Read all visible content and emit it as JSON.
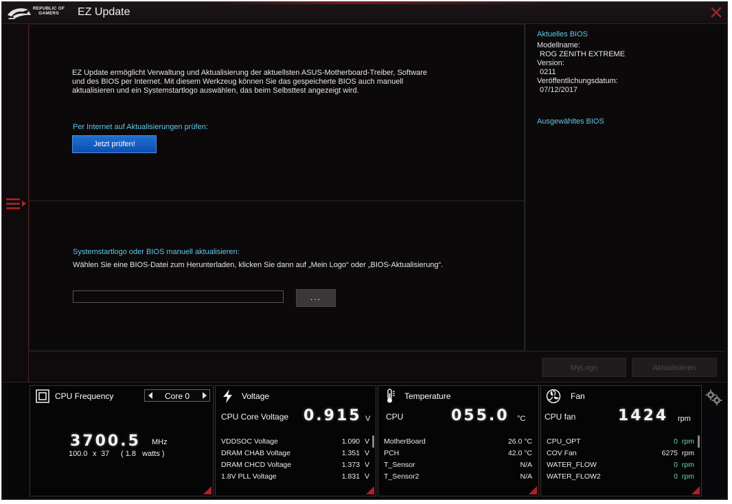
{
  "app": {
    "brand_line1": "REPUBLIC OF",
    "brand_line2": "GAMERS",
    "title": "EZ Update"
  },
  "main": {
    "description": "EZ Update ermöglicht Verwaltung und Aktualisierung der aktuellsten ASUS-Motherboard-Treiber, Software und des BIOS per Internet. Mit diesem Werkzeug können Sie das gespeicherte BIOS auch manuell aktualisieren und ein Systemstartlogo auswählen, das beim Selbsttest angezeigt wird.",
    "internet_check_label": "Per Internet auf Aktualisierungen prüfen:",
    "check_button": "Jetzt prüfen!",
    "manual_label": "Systemstartlogo oder BIOS manuell aktualisieren:",
    "manual_hint": "Wählen Sie eine BIOS-Datei zum Herunterladen, klicken Sie dann auf „Mein Logo“ oder „BIOS-Aktualisierung“.",
    "file_value": "",
    "browse_button": "..."
  },
  "bios": {
    "current_heading": "Aktuelles BIOS",
    "model_label": "Modellname:",
    "model_value": "ROG ZENITH EXTREME",
    "version_label": "Version:",
    "version_value": "0211",
    "date_label": "Veröffentlichungsdatum:",
    "date_value": "07/12/2017",
    "selected_heading": "Ausgewähltes BIOS"
  },
  "actions": {
    "mylogo": "MyLogo",
    "update": "Aktualisieren"
  },
  "monitor": {
    "cpu": {
      "title": "CPU Frequency",
      "core_selected": "Core 0",
      "freq_value": "3700.5",
      "freq_unit": "MHz",
      "bclk": "100.0",
      "x": "x",
      "ratio": "37",
      "power": "( 1.8   watts )"
    },
    "voltage": {
      "title": "Voltage",
      "main_label": "CPU Core Voltage",
      "main_value": "0.915",
      "main_unit": "V",
      "rows": [
        {
          "label": "VDDSOC Voltage",
          "value": "1.090",
          "unit": "V"
        },
        {
          "label": "DRAM CHAB Voltage",
          "value": "1.351",
          "unit": "V"
        },
        {
          "label": "DRAM CHCD Voltage",
          "value": "1.373",
          "unit": "V"
        },
        {
          "label": "1.8V PLL Voltage",
          "value": "1.831",
          "unit": "V"
        }
      ]
    },
    "temperature": {
      "title": "Temperature",
      "main_label": "CPU",
      "main_value": "055.0",
      "main_unit": "°C",
      "rows": [
        {
          "label": "MotherBoard",
          "value": "26.0 °C"
        },
        {
          "label": "PCH",
          "value": "42.0 °C"
        },
        {
          "label": "T_Sensor",
          "value": "N/A"
        },
        {
          "label": "T_Sensor2",
          "value": "N/A"
        }
      ]
    },
    "fan": {
      "title": "Fan",
      "main_label": "CPU fan",
      "main_value": "1424",
      "main_unit": "rpm",
      "rows": [
        {
          "label": "CPU_OPT",
          "value": "0",
          "unit": "rpm"
        },
        {
          "label": "COV Fan",
          "value": "6275",
          "unit": "rpm"
        },
        {
          "label": "WATER_FLOW",
          "value": "0",
          "unit": "rpm"
        },
        {
          "label": "WATER_FLOW2",
          "value": "0",
          "unit": "rpm"
        }
      ]
    }
  },
  "colors": {
    "accent_cyan": "#5fc7ea",
    "rog_red": "#b21f26",
    "button_blue": "#1f6fd1"
  }
}
